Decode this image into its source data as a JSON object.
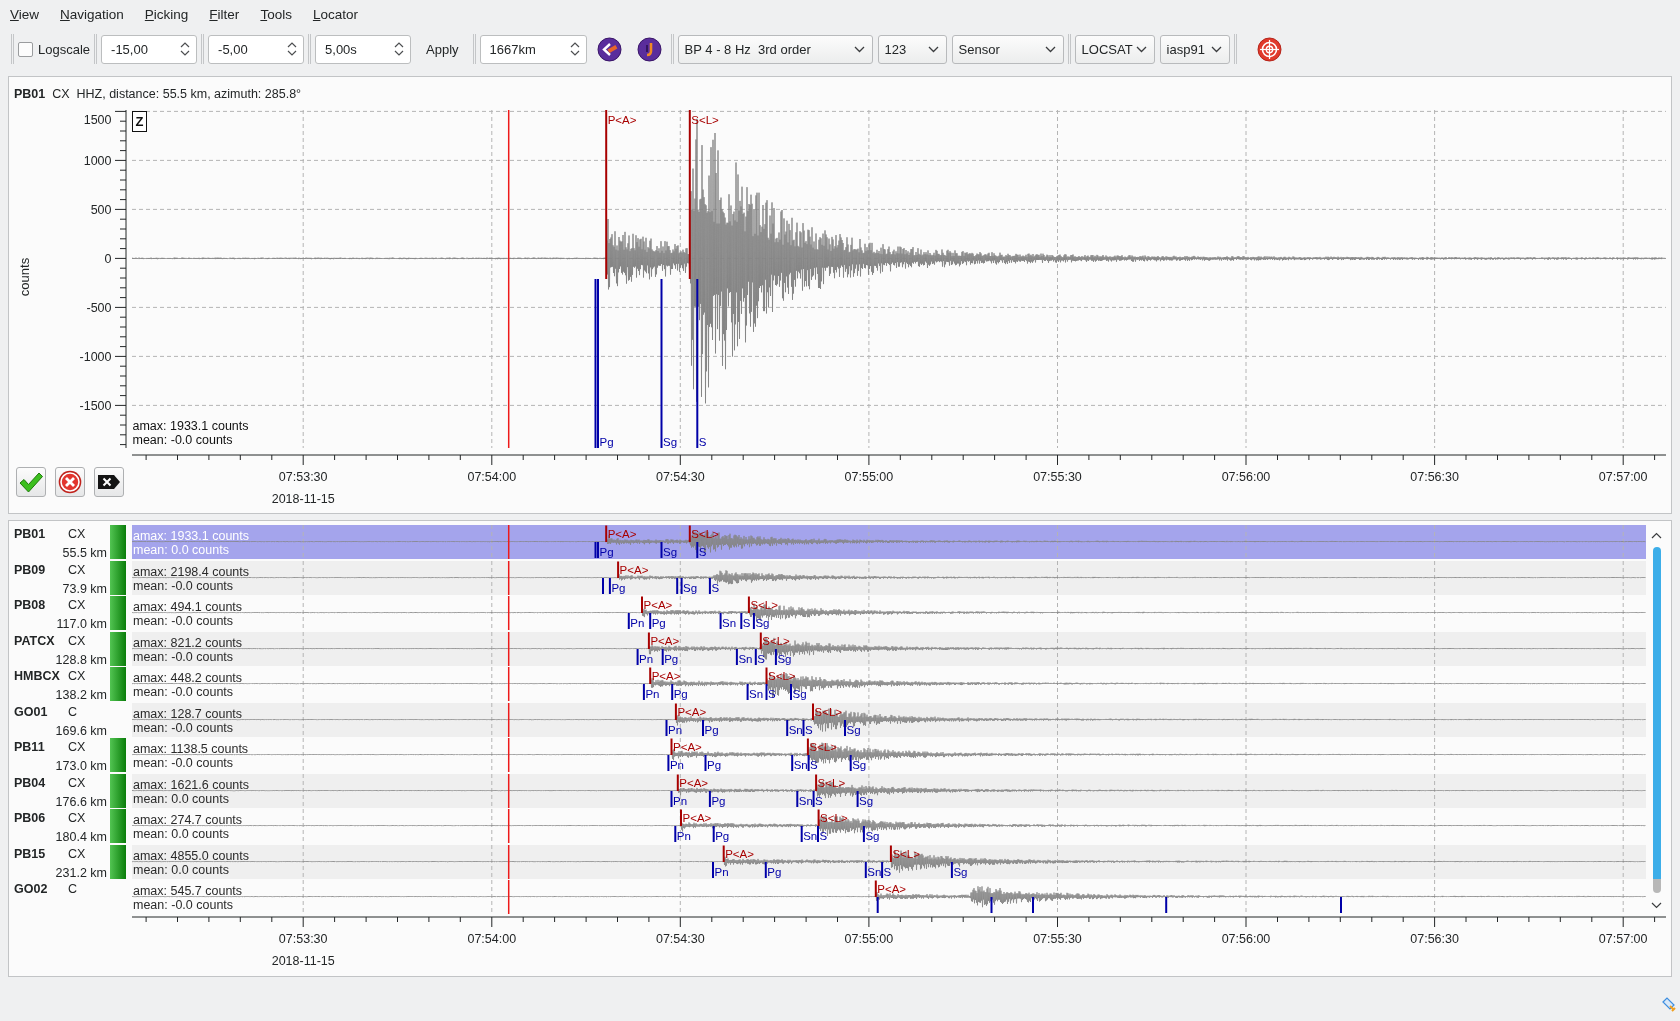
{
  "menu": [
    "View",
    "Navigation",
    "Picking",
    "Filter",
    "Tools",
    "Locator"
  ],
  "toolbar": [
    [
      {
        "kind": "checkbox",
        "label": "Logscale",
        "checked": false
      }
    ],
    [
      {
        "kind": "spinbox",
        "value": "-15,00"
      }
    ],
    [
      {
        "kind": "spinbox",
        "value": "-5,00"
      }
    ],
    [
      {
        "kind": "spinbox",
        "value": "5,00s"
      },
      {
        "kind": "text_button",
        "label": "Apply"
      }
    ],
    [
      {
        "kind": "spinbox",
        "value": "1667km"
      },
      {
        "kind": "ruler_button"
      },
      {
        "kind": "hook_button"
      }
    ],
    [
      {
        "kind": "dropdown",
        "value": "BP 4 - 8 Hz  3rd order"
      },
      {
        "kind": "dropdown",
        "value": "123"
      },
      {
        "kind": "dropdown",
        "value": "Sensor"
      }
    ],
    [
      {
        "kind": "dropdown",
        "value": "LOCSAT"
      },
      {
        "kind": "dropdown",
        "value": "iasp91"
      }
    ],
    [
      {
        "kind": "target_button"
      }
    ]
  ],
  "trace_view": {
    "title": "**PB01**  CX  HHZ, distance: 55.5 km, azimuth: 285.8°",
    "component": "Z",
    "y_label": "counts",
    "y_ticks": [
      "1500",
      "1000",
      "500",
      "0",
      "-500",
      "-1000",
      "-1500"
    ],
    "amax": "amax: 1933.1 counts",
    "mean": "mean: -0.0 counts",
    "picks": [
      {
        "kind": "manual",
        "label": "P<A>"
      },
      {
        "kind": "manual",
        "label": "S<L>"
      },
      {
        "kind": "predicted"
      },
      {
        "kind": "predicted",
        "label": "Pg"
      },
      {
        "kind": "predicted",
        "label": "Sg"
      },
      {
        "kind": "predicted",
        "label": "S"
      }
    ],
    "time_ticks": [
      "07:53:30",
      "07:54:00",
      "07:54:30",
      "07:55:00",
      "07:55:30",
      "07:56:00",
      "07:56:30",
      "07:57:00"
    ],
    "date": "2018-11-15",
    "actions": [
      {
        "kind": "accept"
      },
      {
        "kind": "reject"
      },
      {
        "kind": "clear"
      }
    ]
  },
  "stations": {
    "rows": [
      {
        "station": "PB01",
        "network": "CX",
        "distance": "55.5 km",
        "enabled": true,
        "selected": true,
        "amax": "amax: 1933.1 counts",
        "mean": "mean: 0.0 counts",
        "picks": [
          {
            "kind": "manual",
            "label": "P<A>"
          },
          {
            "kind": "manual",
            "label": "S<L>"
          },
          {
            "kind": "predicted"
          },
          {
            "kind": "predicted",
            "label": "Pg"
          },
          {
            "kind": "predicted",
            "label": "Sg"
          },
          {
            "kind": "predicted",
            "label": "S"
          }
        ]
      },
      {
        "station": "PB09",
        "network": "CX",
        "distance": "73.9 km",
        "enabled": true,
        "selected": false,
        "amax": "amax: 2198.4 counts",
        "mean": "mean: -0.0 counts",
        "picks": [
          {
            "kind": "manual",
            "label": "P<A>"
          },
          {
            "kind": "predicted"
          },
          {
            "kind": "predicted",
            "label": "Pg"
          },
          {
            "kind": "predicted"
          },
          {
            "kind": "predicted",
            "label": "Sg"
          },
          {
            "kind": "predicted",
            "label": "S"
          }
        ]
      },
      {
        "station": "PB08",
        "network": "CX",
        "distance": "117.0 km",
        "enabled": true,
        "selected": false,
        "amax": "amax: 494.1 counts",
        "mean": "mean: -0.0 counts",
        "picks": [
          {
            "kind": "manual",
            "label": "P<A>"
          },
          {
            "kind": "manual",
            "label": "S<L>"
          },
          {
            "kind": "predicted",
            "label": "Pn"
          },
          {
            "kind": "predicted",
            "label": "Pg"
          },
          {
            "kind": "predicted",
            "label": "Sn"
          },
          {
            "kind": "predicted",
            "label": "S"
          },
          {
            "kind": "predicted",
            "label": "Sg"
          }
        ]
      },
      {
        "station": "PATCX",
        "network": "CX",
        "distance": "128.8 km",
        "enabled": true,
        "selected": false,
        "amax": "amax: 821.2 counts",
        "mean": "mean: -0.0 counts",
        "picks": [
          {
            "kind": "manual",
            "label": "P<A>"
          },
          {
            "kind": "manual",
            "label": "S<L>"
          },
          {
            "kind": "predicted",
            "label": "Pn"
          },
          {
            "kind": "predicted",
            "label": "Pg"
          },
          {
            "kind": "predicted",
            "label": "Sn"
          },
          {
            "kind": "predicted",
            "label": "S"
          },
          {
            "kind": "predicted",
            "label": "Sg"
          }
        ]
      },
      {
        "station": "HMBCX",
        "network": "CX",
        "distance": "138.2 km",
        "enabled": true,
        "selected": false,
        "amax": "amax: 448.2 counts",
        "mean": "mean: -0.0 counts",
        "picks": [
          {
            "kind": "manual",
            "label": "P<A>"
          },
          {
            "kind": "manual",
            "label": "S<L>"
          },
          {
            "kind": "predicted",
            "label": "Pn"
          },
          {
            "kind": "predicted",
            "label": "Pg"
          },
          {
            "kind": "predicted",
            "label": "Sn"
          },
          {
            "kind": "predicted",
            "label": "S"
          },
          {
            "kind": "predicted",
            "label": "Sg"
          }
        ]
      },
      {
        "station": "GO01",
        "network": "C",
        "distance": "169.6 km",
        "enabled": false,
        "selected": false,
        "amax": "amax: 128.7 counts",
        "mean": "mean: -0.0 counts",
        "picks": [
          {
            "kind": "manual",
            "label": "P<A>"
          },
          {
            "kind": "manual",
            "label": "S<L>"
          },
          {
            "kind": "predicted",
            "label": "Pn"
          },
          {
            "kind": "predicted",
            "label": "Pg"
          },
          {
            "kind": "predicted",
            "label": "Sn"
          },
          {
            "kind": "predicted",
            "label": "S"
          },
          {
            "kind": "predicted",
            "label": "Sg"
          }
        ]
      },
      {
        "station": "PB11",
        "network": "CX",
        "distance": "173.0 km",
        "enabled": true,
        "selected": false,
        "amax": "amax: 1138.5 counts",
        "mean": "mean: -0.0 counts",
        "picks": [
          {
            "kind": "manual",
            "label": "P<A>"
          },
          {
            "kind": "manual",
            "label": "S<L>"
          },
          {
            "kind": "predicted",
            "label": "Pn"
          },
          {
            "kind": "predicted",
            "label": "Pg"
          },
          {
            "kind": "predicted",
            "label": "Sn"
          },
          {
            "kind": "predicted",
            "label": "S"
          },
          {
            "kind": "predicted",
            "label": "Sg"
          }
        ]
      },
      {
        "station": "PB04",
        "network": "CX",
        "distance": "176.6 km",
        "enabled": true,
        "selected": false,
        "amax": "amax: 1621.6 counts",
        "mean": "mean: 0.0 counts",
        "picks": [
          {
            "kind": "manual",
            "label": "P<A>"
          },
          {
            "kind": "manual",
            "label": "S<L>"
          },
          {
            "kind": "predicted",
            "label": "Pn"
          },
          {
            "kind": "predicted",
            "label": "Pg"
          },
          {
            "kind": "predicted",
            "label": "Sn"
          },
          {
            "kind": "predicted",
            "label": "S"
          },
          {
            "kind": "predicted",
            "label": "Sg"
          }
        ]
      },
      {
        "station": "PB06",
        "network": "CX",
        "distance": "180.4 km",
        "enabled": true,
        "selected": false,
        "amax": "amax: 274.7 counts",
        "mean": "mean: 0.0 counts",
        "picks": [
          {
            "kind": "manual",
            "label": "P<A>"
          },
          {
            "kind": "manual",
            "label": "S<L>"
          },
          {
            "kind": "predicted",
            "label": "Pn"
          },
          {
            "kind": "predicted",
            "label": "Pg"
          },
          {
            "kind": "predicted",
            "label": "Sn"
          },
          {
            "kind": "predicted",
            "label": "S"
          },
          {
            "kind": "predicted",
            "label": "Sg"
          }
        ]
      },
      {
        "station": "PB15",
        "network": "CX",
        "distance": "231.2 km",
        "enabled": true,
        "selected": false,
        "amax": "amax: 4855.0 counts",
        "mean": "mean: 0.0 counts",
        "picks": [
          {
            "kind": "manual",
            "label": "P<A>"
          },
          {
            "kind": "manual",
            "label": "S<L>"
          },
          {
            "kind": "predicted",
            "label": "Pn"
          },
          {
            "kind": "predicted",
            "label": "Pg"
          },
          {
            "kind": "predicted",
            "label": "Sn"
          },
          {
            "kind": "predicted",
            "label": "S"
          },
          {
            "kind": "predicted",
            "label": "Sg"
          }
        ]
      },
      {
        "station": "GO02",
        "network": "C",
        "enabled": false,
        "selected": false,
        "amax": "amax: 545.7 counts",
        "mean": "mean: -0.0 counts",
        "picks": [
          {
            "kind": "manual",
            "label": "P<A>"
          },
          {
            "kind": "predicted"
          },
          {
            "kind": "predicted"
          },
          {
            "kind": "predicted"
          },
          {
            "kind": "predicted"
          },
          {
            "kind": "predicted"
          }
        ]
      }
    ],
    "time_ticks": [
      "07:53:30",
      "07:54:00",
      "07:54:30",
      "07:55:00",
      "07:55:30",
      "07:56:00",
      "07:56:30",
      "07:57:00"
    ],
    "date": "2018-11-15"
  }
}
